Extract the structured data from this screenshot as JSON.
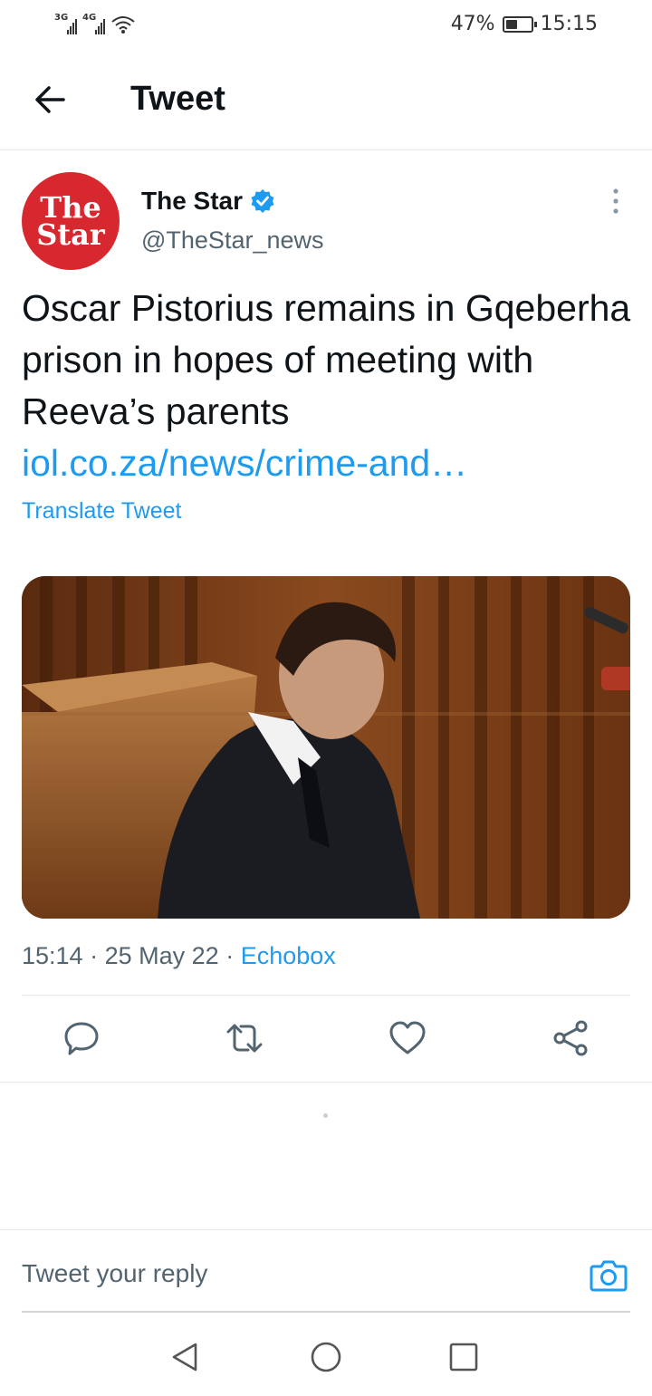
{
  "status_bar": {
    "sim1": "3G",
    "sim2": "4G",
    "battery": "47%",
    "time": "15:15"
  },
  "header": {
    "title": "Tweet",
    "back_icon": "arrow-left-icon"
  },
  "tweet": {
    "avatar_line1": "The",
    "avatar_line2": "Star",
    "author_name": "The Star",
    "verified_icon": "verified-badge-icon",
    "handle": "@TheStar_news",
    "text": "Oscar Pistorius remains in Gqeberha prison in hopes of meeting with Reeva’s parents",
    "link": "iol.co.za/news/crime-and…",
    "translate_label": "Translate Tweet",
    "time": "15:14",
    "date": "25 May 22",
    "source": "Echobox"
  },
  "actions": [
    {
      "icon": "reply-icon"
    },
    {
      "icon": "retweet-icon"
    },
    {
      "icon": "like-icon"
    },
    {
      "icon": "share-icon"
    }
  ],
  "reply": {
    "placeholder": "Tweet your reply",
    "camera_icon": "camera-icon"
  },
  "colors": {
    "accent": "#1d9bf0",
    "avatar_bg": "#d7282f",
    "secondary_text": "#536471"
  }
}
